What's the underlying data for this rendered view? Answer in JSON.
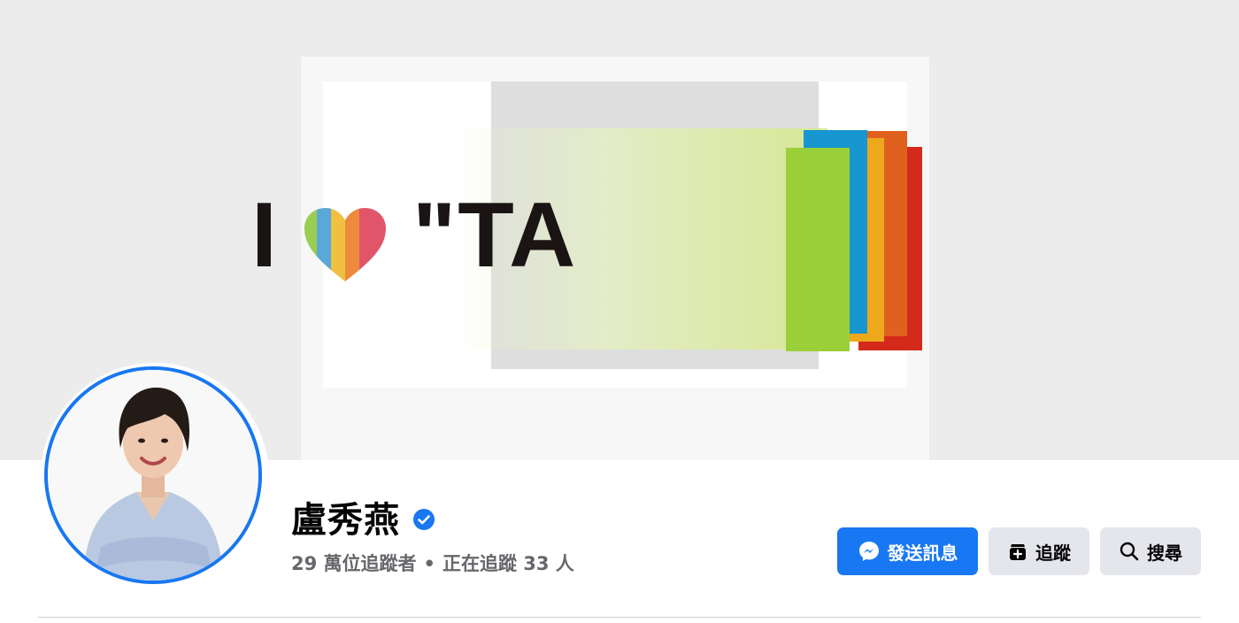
{
  "cover": {
    "text_i": "I",
    "text_rest": "\"TA"
  },
  "profile": {
    "name": "盧秀燕",
    "followers": "29 萬位追蹤者",
    "separator": "•",
    "following": "正在追蹤 33 人",
    "verified": true
  },
  "actions": {
    "message_label": "發送訊息",
    "follow_label": "追蹤",
    "search_label": "搜尋"
  },
  "colors": {
    "accent": "#1877f2",
    "secondary_button": "#e4e6eb",
    "muted_text": "#65676b"
  },
  "icons": {
    "verified": "verified-badge-icon",
    "messenger": "messenger-icon",
    "follow": "follow-add-icon",
    "search": "search-icon",
    "heart": "rainbow-heart-icon"
  }
}
